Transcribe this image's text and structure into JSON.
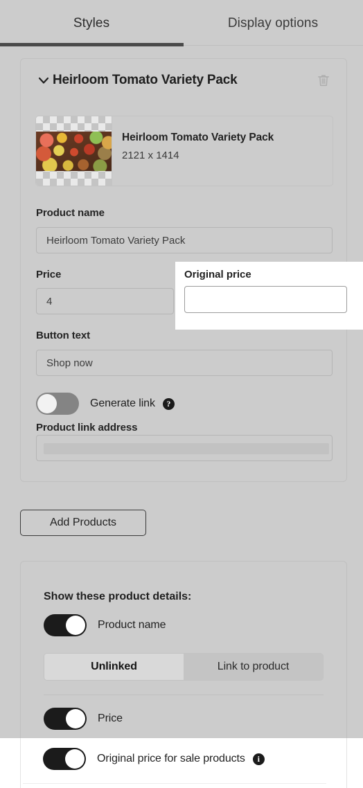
{
  "tabs": [
    {
      "label": "Styles",
      "active": true
    },
    {
      "label": "Display options",
      "active": false
    }
  ],
  "product_card": {
    "title": "Heirloom Tomato Variety Pack",
    "chevron_icon": "chevron-down-icon",
    "delete_icon": "trash-icon",
    "image": {
      "name": "Heirloom Tomato Variety Pack",
      "dimensions": "2121 x 1414"
    },
    "fields": {
      "product_name_label": "Product name",
      "product_name_value": "Heirloom Tomato Variety Pack",
      "price_label": "Price",
      "price_value": "4",
      "button_text_label": "Button text",
      "button_text_value": "Shop now",
      "product_link_label": "Product link address",
      "product_link_value": ""
    },
    "generate_link": {
      "label": "Generate link",
      "state": "off",
      "help_icon": "help-icon",
      "help_glyph": "?"
    }
  },
  "overlay_popover": {
    "label": "Original price",
    "value": "",
    "placeholder": ""
  },
  "add_products_button": "Add Products",
  "details_card": {
    "heading": "Show these product details:",
    "rows": [
      {
        "label": "Product name",
        "state": "on",
        "info": false
      },
      {
        "label": "Price",
        "state": "on",
        "info": false
      },
      {
        "label": "Original price for sale products",
        "state": "on",
        "info": true,
        "info_glyph": "i",
        "hovered": true
      }
    ],
    "link_segment": {
      "options": [
        {
          "label": "Unlinked",
          "selected": true
        },
        {
          "label": "Link to product",
          "selected": false
        }
      ]
    }
  },
  "colors": {
    "background": "#cccccc",
    "accent_dark": "#1b1b1b",
    "tab_underline": "#4a4a4a",
    "toggle_off": "#848484",
    "hover_row": "#ffffff"
  }
}
